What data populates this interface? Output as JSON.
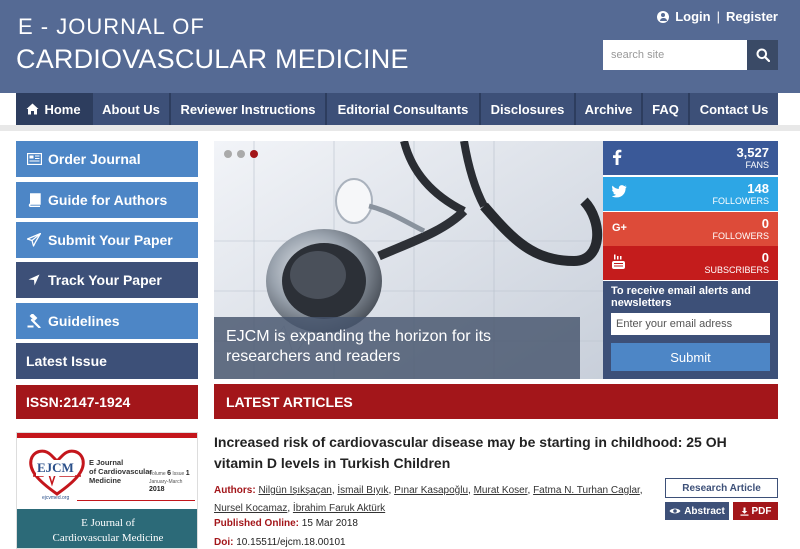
{
  "header": {
    "logo_line1": "E - JOURNAL OF",
    "logo_line2": "CARDIOVASCULAR MEDICINE",
    "login": "Login",
    "separator": "|",
    "register": "Register",
    "search_placeholder": "search site"
  },
  "nav": {
    "items": [
      {
        "label": "Home",
        "icon": "home-icon",
        "active": true
      },
      {
        "label": "About Us"
      },
      {
        "label": "Reviewer Instructions"
      },
      {
        "label": "Editorial Consultants"
      },
      {
        "label": "Disclosures"
      },
      {
        "label": "Archive"
      },
      {
        "label": "FAQ"
      },
      {
        "label": "Contact Us"
      }
    ]
  },
  "sidebar": {
    "items": [
      {
        "label": "Order Journal",
        "icon": "newspaper-icon"
      },
      {
        "label": "Guide for Authors",
        "icon": "book-icon"
      },
      {
        "label": "Submit Your Paper",
        "icon": "paper-plane-icon"
      },
      {
        "label": "Track Your Paper",
        "icon": "location-arrow-icon"
      },
      {
        "label": "Guidelines",
        "icon": "gavel-icon"
      },
      {
        "label": "Latest Issue"
      }
    ],
    "issn": "ISSN:2147-1924",
    "cover": {
      "logo_text": "EJCM",
      "journal_line1": "E Journal",
      "journal_line2": "of Cardiovascular",
      "journal_line3": "Medicine",
      "volume_label": "Volume",
      "volume": "6",
      "issue_label": "Issue",
      "issue": "1",
      "period": "January-March",
      "year": "2018",
      "website": "ejcvmed.org",
      "title_line1": "E Journal of",
      "title_line2": "Cardiovascular Medicine"
    }
  },
  "slider": {
    "caption": "EJCM is expanding the horizon for its researchers and readers",
    "dots": 3,
    "active_dot": 3
  },
  "social": {
    "facebook": {
      "icon": "facebook-icon",
      "count": "3,527",
      "label": "FANS"
    },
    "twitter": {
      "icon": "twitter-icon",
      "count": "148",
      "label": "FOLLOWERS"
    },
    "googleplus": {
      "icon": "google-plus-icon",
      "glyph": "G+",
      "count": "0",
      "label": "FOLLOWERS"
    },
    "youtube": {
      "icon": "youtube-icon",
      "count": "0",
      "label": "SUBSCRIBERS"
    }
  },
  "newsletter": {
    "text": "To receive email alerts and newsletters",
    "placeholder": "Enter your email adress",
    "button": "Submit"
  },
  "latest": {
    "heading": "LATEST ARTICLES",
    "article": {
      "title": "Increased risk of cardiovascular disease may be starting in childhood: 25 OH vitamin D levels in Turkish Children",
      "authors_label": "Authors:",
      "authors": [
        "Nilgün Işıkşaçan",
        "İsmail Bıyık",
        "Pınar Kasapoğlu",
        "Murat Koser",
        "Fatma N. Turhan Caglar",
        "Nursel Kocamaz",
        "İbrahim Faruk Aktürk"
      ],
      "published_label": "Published Online:",
      "published": "15 Mar 2018",
      "doi_label": "Doi:",
      "doi": "10.15511/ejcm.18.00101",
      "type": "Research Article",
      "abstract_btn": "Abstract",
      "pdf_btn": "PDF"
    }
  },
  "colors": {
    "header": "#556a94",
    "nav": "#3d5078",
    "accent_red": "#a3161a",
    "light_blue": "#4d86c6"
  }
}
